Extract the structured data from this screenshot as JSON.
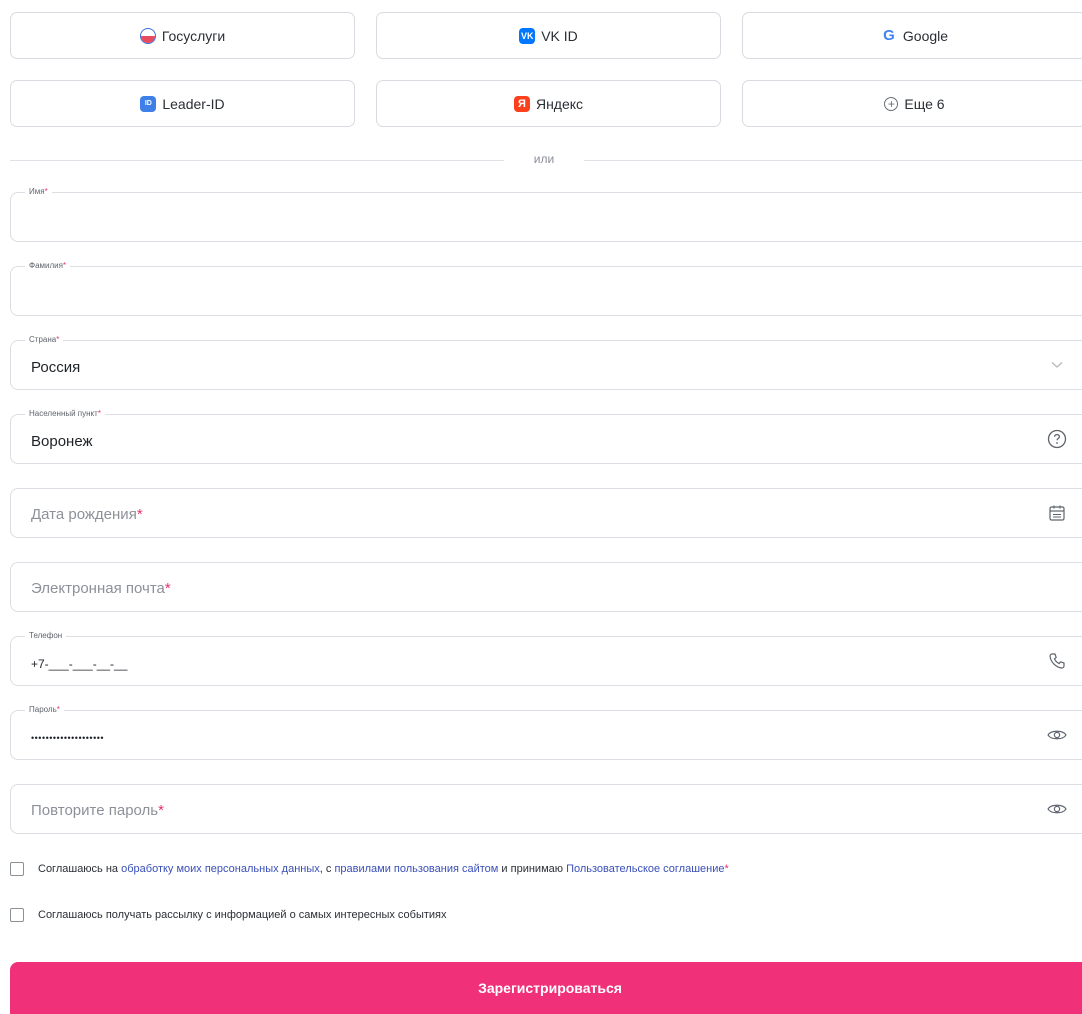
{
  "social": {
    "gosuslugi": "Госуслуги",
    "vkid": "VK ID",
    "google": "Google",
    "leaderid": "Leader-ID",
    "yandex": "Яндекс",
    "more": "Еще 6",
    "vk_icon_text": "VK",
    "google_icon_text": "G",
    "leader_icon_text": "ID",
    "yandex_icon_text": "Я",
    "more_icon_text": "+"
  },
  "divider_text": "или",
  "form": {
    "first_name": {
      "label": "Имя",
      "value": ""
    },
    "last_name": {
      "label": "Фамилия",
      "value": ""
    },
    "country": {
      "label": "Страна",
      "value": "Россия"
    },
    "city": {
      "label": "Населенный пункт",
      "value": "Воронеж"
    },
    "birth_date": {
      "placeholder": "Дата рождения"
    },
    "email": {
      "placeholder": "Электронная почта"
    },
    "phone": {
      "label": "Телефон",
      "value": "+7-___-___-__-__"
    },
    "password": {
      "label": "Пароль",
      "value": "••••••••••••••••••••"
    },
    "password_repeat": {
      "placeholder": "Повторите пароль"
    },
    "required_mark": "*"
  },
  "agreements": {
    "terms": {
      "prefix": "Соглашаюсь на ",
      "link1": "обработку моих персональных данных",
      "mid1": ", с ",
      "link2": "правилами пользования сайтом",
      "mid2": " и принимаю ",
      "link3": "Пользовательское соглашение",
      "required_mark": "*"
    },
    "newsletter": "Соглашаюсь получать рассылку с информацией о самых интересных событиях"
  },
  "submit_label": "Зарегистрироваться",
  "colors": {
    "accent": "#f0317a",
    "link": "#3a4fb8",
    "required": "#e3336f"
  },
  "icons": {
    "country_field": "chevron-down-icon",
    "city_field": "help-circle-icon",
    "birth_date_field": "calendar-icon",
    "phone_field": "phone-icon",
    "password_field": "eye-icon",
    "password_repeat_field": "eye-icon",
    "more_button": "plus-circle-icon"
  }
}
